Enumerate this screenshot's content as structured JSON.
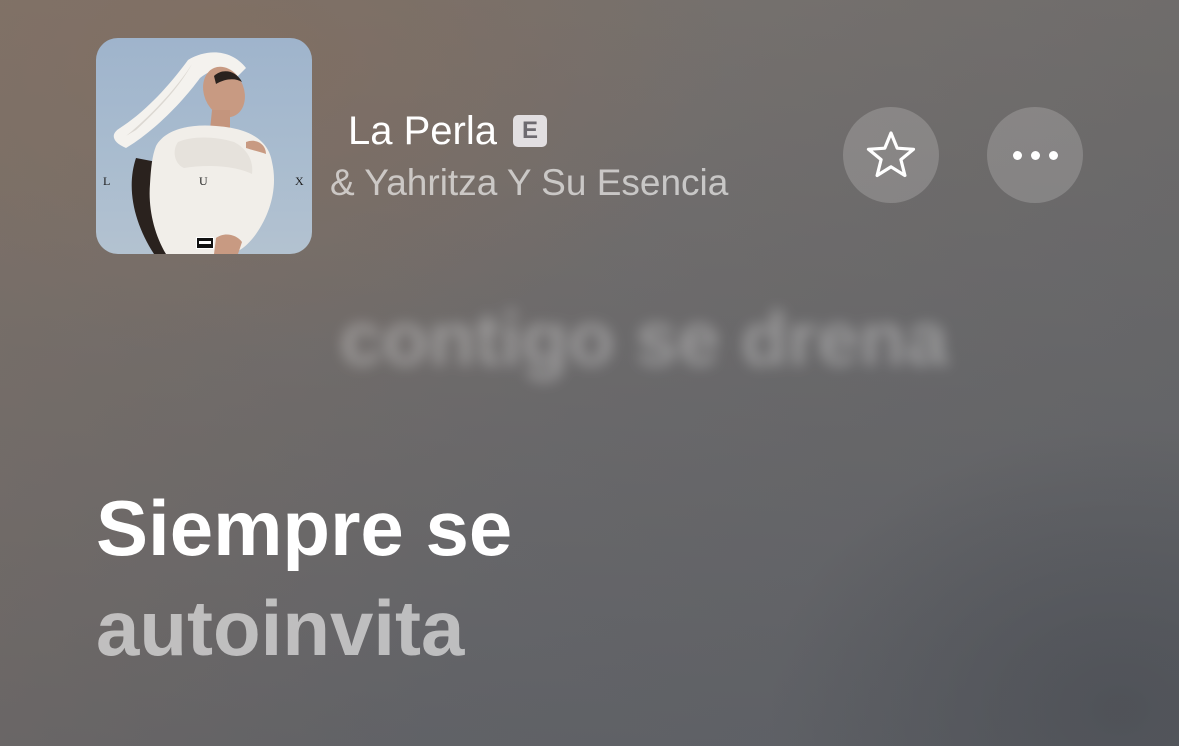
{
  "track": {
    "title": "La Perla",
    "explicit_badge": "E",
    "artists": "& Yahritza Y Su Esencia"
  },
  "artwork": {
    "letters": [
      "L",
      "U",
      "X"
    ]
  },
  "actions": {
    "favorite_icon": "star-outline-icon",
    "more_icon": "ellipsis-icon"
  },
  "lyrics": {
    "previous_line": "contigo se drena",
    "current_line_1": "Siempre se",
    "current_line_2": "autoinvita"
  },
  "colors": {
    "text_primary": "#ffffff",
    "text_secondary": "rgba(255,255,255,0.62)",
    "badge_bg": "#ebe8ec"
  }
}
